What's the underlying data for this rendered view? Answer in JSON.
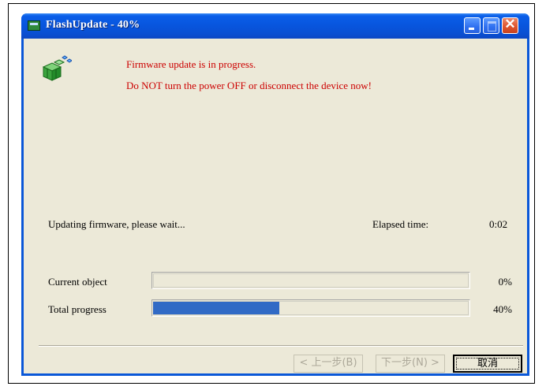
{
  "window": {
    "title": "FlashUpdate - 40%",
    "app_icon": "setup-boxes-icon",
    "controls": [
      "minimize-icon",
      "maximize-icon",
      "close-icon"
    ],
    "close_glyph": "✕"
  },
  "messages": {
    "line1": "Firmware update is in progress.",
    "line2": "Do NOT turn the power OFF or disconnect the device now!",
    "color": "#cc0000"
  },
  "status": {
    "text": "Updating firmware, please wait...",
    "elapsed_label": "Elapsed time:",
    "elapsed_value": "0:02"
  },
  "progress": {
    "current_label": "Current object",
    "current_value": 0,
    "current_text": "0%",
    "total_label": "Total progress",
    "total_value": 40,
    "total_text": "40%",
    "fill_color": "#316ac5"
  },
  "buttons": {
    "back": "< 上一步(B)",
    "next": "下一步(N) >",
    "cancel": "取消"
  },
  "colors": {
    "titlebar": "#0855dd",
    "dialog_bg": "#ece9d8"
  }
}
